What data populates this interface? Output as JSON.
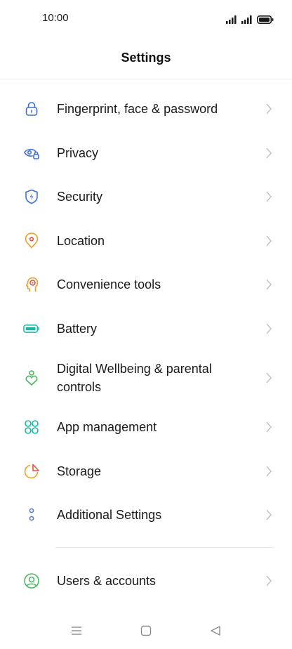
{
  "status": {
    "time": "10:00"
  },
  "header": {
    "title": "Settings"
  },
  "settings": {
    "items": [
      {
        "label": "Fingerprint, face & password",
        "icon": "lock-icon",
        "color": "#3d6fd8"
      },
      {
        "label": "Privacy",
        "icon": "privacy-eye-icon",
        "color": "#3d6fd8"
      },
      {
        "label": "Security",
        "icon": "security-shield-icon",
        "color": "#3d6fd8"
      },
      {
        "label": "Location",
        "icon": "location-pin-icon",
        "color": "#f0a020"
      },
      {
        "label": "Convenience tools",
        "icon": "convenience-head-icon",
        "color": "#f0a020"
      },
      {
        "label": "Battery",
        "icon": "battery-icon",
        "color": "#17b8a6"
      },
      {
        "label": "Digital Wellbeing & parental controls",
        "icon": "wellbeing-heart-icon",
        "color": "#4cb860"
      },
      {
        "label": "App management",
        "icon": "app-grid-icon",
        "color": "#17b8a6"
      },
      {
        "label": "Storage",
        "icon": "storage-pie-icon",
        "color": "#f0a020"
      },
      {
        "label": "Additional Settings",
        "icon": "more-dots-icon",
        "color": "#5a7fc0"
      }
    ],
    "accounts": {
      "label": "Users & accounts",
      "icon": "user-icon",
      "color": "#4cb860"
    }
  },
  "nav": {
    "menu": "menu-icon",
    "home": "home-icon",
    "back": "back-icon"
  }
}
